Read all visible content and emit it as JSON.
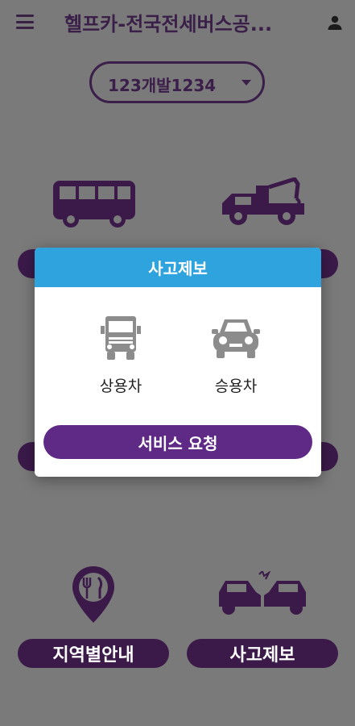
{
  "appbar": {
    "title": "헬프카-전국전세버스공...",
    "menu_icon": "hamburger-menu-icon",
    "account_icon": "person-icon"
  },
  "selector": {
    "value": "123개발1234",
    "icon": "dropdown-arrow-icon"
  },
  "background": {
    "region_guide_label": "지역별안내",
    "accident_report_label": "사고제보",
    "icons": [
      "bus-icon",
      "tow-truck-icon",
      "map-pin-restaurant-icon",
      "car-crash-icon"
    ]
  },
  "dialog": {
    "title": "사고제보",
    "options": [
      {
        "label": "상용차",
        "icon": "truck-icon"
      },
      {
        "label": "승용차",
        "icon": "car-icon"
      }
    ],
    "submit_label": "서비스 요청"
  },
  "colors": {
    "primary_purple": "#5f2a85",
    "header_blue": "#2ea3dd",
    "dark_purple": "#3b1a4a",
    "icon_gray": "#8c8c8c"
  }
}
